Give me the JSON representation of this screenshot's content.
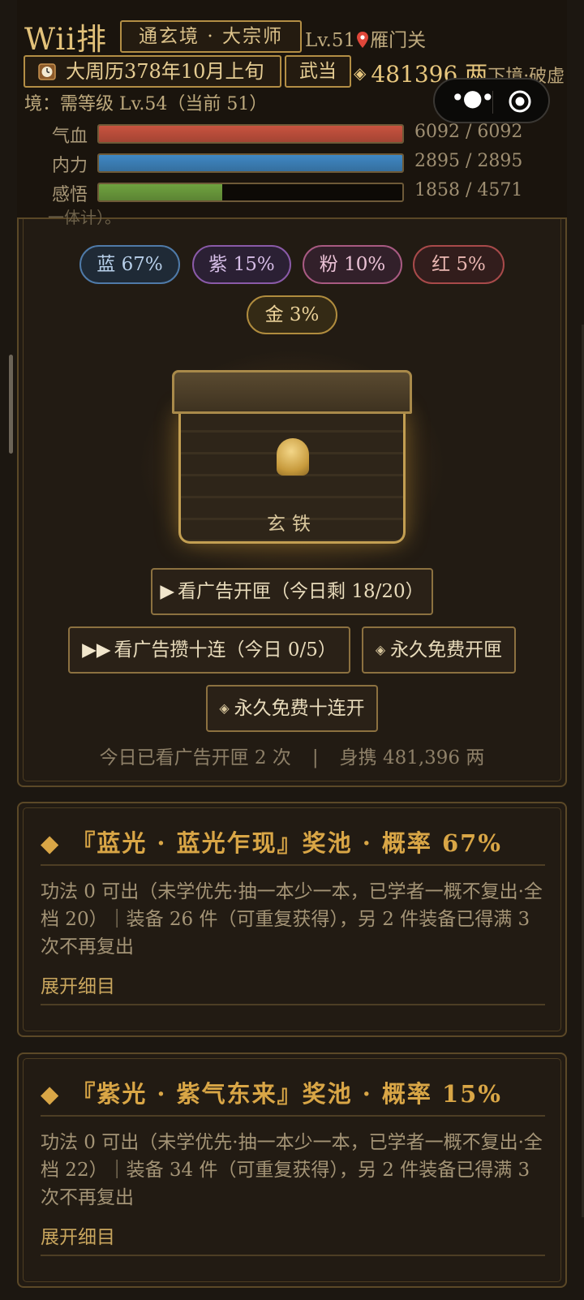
{
  "header": {
    "player_name": "Wii排",
    "realm": "通玄境 · 大宗师",
    "level": "Lv.51",
    "location": "雁门关",
    "date": "大周历378年10月上旬",
    "sect": "武当",
    "money": "481396 两",
    "money_tail": "下境·破虚",
    "realm_requirement": "境：需等级 Lv.54（当前 51）",
    "overlap_text": "一体计）。"
  },
  "stats": [
    {
      "label": "气血",
      "value": "6092 / 6092",
      "ratio": 1.0,
      "color": "#c9533f"
    },
    {
      "label": "内力",
      "value": "2895 / 2895",
      "ratio": 1.0,
      "color": "#3f88c4"
    },
    {
      "label": "感悟",
      "value": "1858 / 4571",
      "ratio": 0.406,
      "color": "#6fa23f"
    }
  ],
  "rates": [
    {
      "label": "蓝 67%",
      "border": "#4f7aa8",
      "bg": "#1f2a36",
      "text": "#b8d0ea"
    },
    {
      "label": "紫 15%",
      "border": "#8a5aa8",
      "bg": "#2b2034",
      "text": "#d6bde6"
    },
    {
      "label": "粉 10%",
      "border": "#a85a82",
      "bg": "#32202a",
      "text": "#ebc2d6"
    },
    {
      "label": "红 5%",
      "border": "#a84a4a",
      "bg": "#321d1c",
      "text": "#eab7b2"
    },
    {
      "label": "金 3%",
      "border": "#b08c3e",
      "bg": "#342a15",
      "text": "#ecd39a"
    }
  ],
  "chest": {
    "label": "玄铁"
  },
  "buttons": {
    "watch_ad_open": "看广告开匣（今日剩 18/20）",
    "watch_ad_ten": "看广告攒十连（今日 0/5）",
    "free_open": "永久免费开匣",
    "free_ten": "永久免费十连开"
  },
  "summary": {
    "ads_watched": "今日已看广告开匣 2 次",
    "divider": "|",
    "carrying": "身携 481,396 两"
  },
  "pools": [
    {
      "title": "『蓝光 · 蓝光乍现』奖池 · 概率 67%",
      "desc": "功法 0 可出（未学优先·抽一本少一本，已学者一概不复出·全档 20）｜装备 26 件（可重复获得），另 2 件装备已得满 3 次不再复出",
      "expand": "展开细目"
    },
    {
      "title": "『紫光 · 紫气东来』奖池 · 概率 15%",
      "desc": "功法 0 可出（未学优先·抽一本少一本，已学者一概不复出·全档 22）｜装备 34 件（可重复获得），另 2 件装备已得满 3 次不再复出",
      "expand": "展开细目"
    }
  ],
  "icons": {
    "clock": "clock-icon",
    "pin": "location-pin-icon",
    "diamond": "diamond-icon",
    "play": "play-icon",
    "fast_forward": "fast-forward-icon",
    "menu_dots": "more-dots-icon",
    "close_target": "miniprogram-close-icon"
  }
}
